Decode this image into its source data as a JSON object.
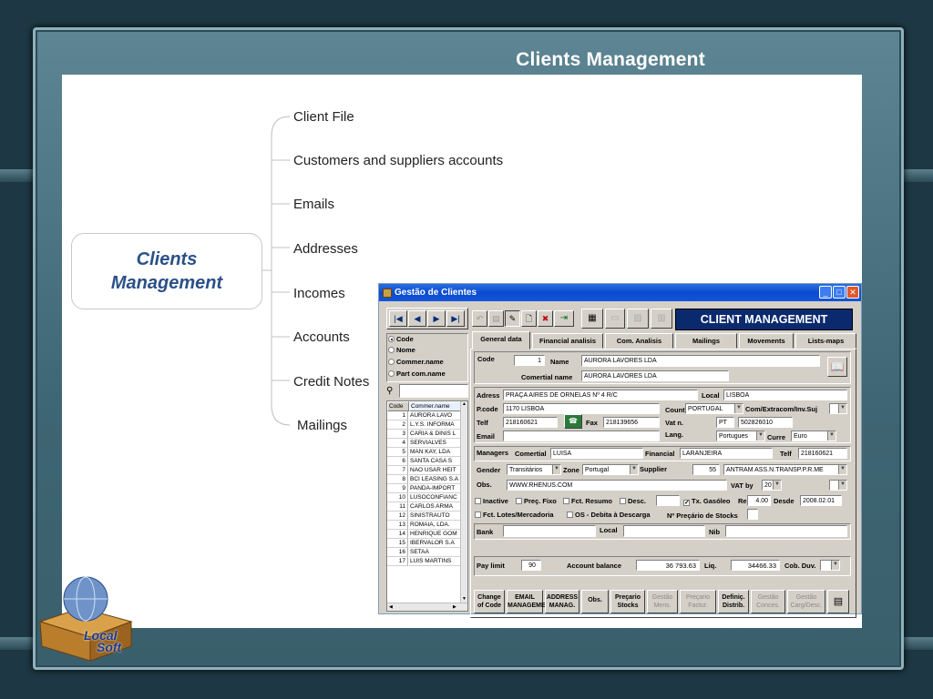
{
  "slide": {
    "title": "Clients Management",
    "center_node": "Clients\nManagement",
    "branches": [
      "Client File",
      "Customers and suppliers accounts",
      "Emails",
      "Addresses",
      "Incomes",
      "Accounts",
      "Credit Notes",
      "Mailings"
    ],
    "logo": {
      "line1": "Local",
      "line2": "Soft"
    }
  },
  "window": {
    "title": "Gestão de Clientes",
    "banner": "CLIENT MANAGEMENT",
    "search_options": [
      "Code",
      "Nome",
      "Commer.name",
      "Part com.name"
    ],
    "list": {
      "headers": [
        "Code",
        "Commer.name"
      ],
      "rows": [
        [
          "1",
          "AURORA LAVO"
        ],
        [
          "2",
          "L.Y.S. INFORMA"
        ],
        [
          "3",
          "CARIA & DINIS L"
        ],
        [
          "4",
          "SERVIALVES"
        ],
        [
          "5",
          "MAN KAY, LDA"
        ],
        [
          "6",
          "SANTA CASA S"
        ],
        [
          "7",
          "NAO USAR HEIT"
        ],
        [
          "8",
          "BCI LEASING S.A"
        ],
        [
          "9",
          "PANDA-IMPORT"
        ],
        [
          "10",
          "LUSOCONFIANC"
        ],
        [
          "11",
          "CARLOS ARMA"
        ],
        [
          "12",
          "SINISTRAUTO"
        ],
        [
          "13",
          "ROMAIA, LDA."
        ],
        [
          "14",
          "HENRIQUE GOM"
        ],
        [
          "15",
          "IBERVALOR S.A"
        ],
        [
          "16",
          "SETAA"
        ],
        [
          "17",
          "LUIS MARTINS"
        ]
      ]
    },
    "tabs": [
      "General data",
      "Financial analisis",
      "Com. Analisis",
      "Mailings",
      "Movements",
      "Lists-maps"
    ],
    "labels": {
      "code": "Code",
      "name": "Name",
      "comertial_name": "Comertial name",
      "adress": "Adress",
      "local": "Local",
      "pcode": "P.code",
      "country": "Count",
      "com_extracom": "Com/Extracom/Inv.Suj",
      "telf": "Telf",
      "fax": "Fax",
      "vat_n": "Vat n.",
      "email": "Email",
      "lang": "Lang.",
      "currency": "Curre",
      "managers": "Managers",
      "comertial": "Comertial",
      "financial": "Financial",
      "telf2": "Telf",
      "gender": "Gender",
      "zone": "Zone",
      "supplier": "Supplier",
      "obs": "Obs.",
      "vat_by": "VAT by",
      "inactive": "Inactive",
      "preco_fixo": "Preç. Fixo",
      "fct_resumo": "Fct. Resumo",
      "desc": "Desc.",
      "tx_gasoleo": "Tx. Gasóleo",
      "re": "Re",
      "desde": "Desde",
      "fct_lotes": "Fct. Lotes/Mercadoria",
      "os_debita": "OS - Debita à Descarga",
      "n_precario": "Nº Preçário de Stocks",
      "bank": "Bank",
      "local2": "Local",
      "nib": "Nib",
      "pay_limit": "Pay limit",
      "account_balance": "Account balance",
      "liq": "Liq.",
      "cob_duv": "Cob. Duv."
    },
    "values": {
      "code": "1",
      "name": "AURORA LAVORES LDA",
      "comertial_name": "AURORA LAVORES LDA",
      "adress": "PRAÇA AIRES DE ORNELAS Nº 4 R/C",
      "local": "LISBOA",
      "pcode": "1170 LISBOA",
      "country": "PORTUGAL",
      "telf": "218160621",
      "fax": "218139656",
      "vat_prefix": "PT",
      "vat_n": "502826010",
      "lang": "Portugues",
      "currency": "Euro",
      "comertial": "LUISA",
      "financial": "LARANJEIRA",
      "telf2": "218160621",
      "gender": "Transitários",
      "zone": "Portugal",
      "supplier_code": "55",
      "supplier_name": "ANTRAM ASS.N.TRANSP.P.R.ME",
      "obs": "WWW.RHENUS.COM",
      "vat_by": "20",
      "tx_gasoleo": "4.00",
      "desde": "2008.02.01",
      "pay_limit": "90",
      "account_balance": "36 793.63",
      "liq": "34466.33"
    },
    "bottom_buttons": [
      {
        "label": "Change\nof Code",
        "enabled": true
      },
      {
        "label": "EMAIL\nMANAGEMENT",
        "enabled": true
      },
      {
        "label": "ADDRESS\nMANAG.",
        "enabled": true
      },
      {
        "label": "Obs.",
        "enabled": true
      },
      {
        "label": "Preçario\nStocks",
        "enabled": true
      },
      {
        "label": "Gestão\nMens.",
        "enabled": false
      },
      {
        "label": "Preçario\nFactur.",
        "enabled": false
      },
      {
        "label": "Definiç.\nDistrib.",
        "enabled": true
      },
      {
        "label": "Gestão\nConces.",
        "enabled": false
      },
      {
        "label": "Gestão\nCarg/Desc.",
        "enabled": false
      }
    ]
  },
  "colors": {
    "title_blue": "#2b5088",
    "banner": "#0b2a6e",
    "frame": "#3e6573"
  }
}
